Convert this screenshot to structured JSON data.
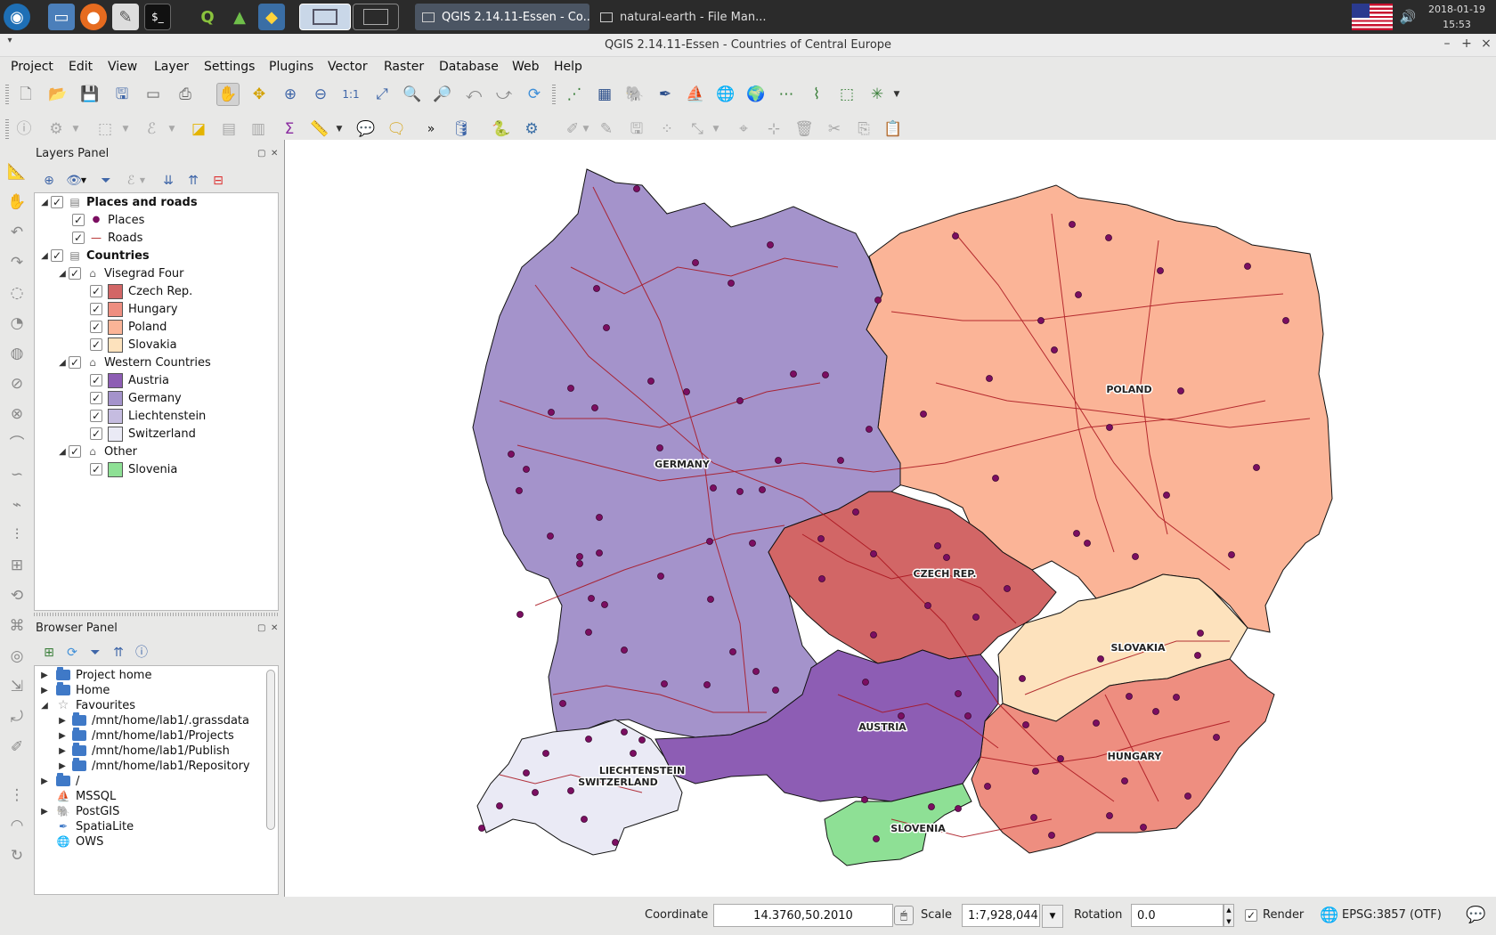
{
  "taskbar": {
    "tasks": [
      "QGIS 2.14.11-Essen - Co...",
      "natural-earth - File Man..."
    ],
    "clock_date": "2018-01-19",
    "clock_time": "15:53"
  },
  "window": {
    "title": "QGIS 2.14.11-Essen - Countries of Central Europe"
  },
  "menu": [
    "Project",
    "Edit",
    "View",
    "Layer",
    "Settings",
    "Plugins",
    "Vector",
    "Raster",
    "Database",
    "Web",
    "Help"
  ],
  "layers_panel": {
    "title": "Layers Panel",
    "groups": [
      {
        "name": "Places and roads",
        "items": [
          "Places",
          "Roads"
        ]
      },
      {
        "name": "Countries",
        "subgroups": [
          {
            "name": "Visegrad Four",
            "layers": [
              {
                "name": "Czech Rep.",
                "color": "#d26666"
              },
              {
                "name": "Hungary",
                "color": "#ee8e80"
              },
              {
                "name": "Poland",
                "color": "#fbb497"
              },
              {
                "name": "Slovakia",
                "color": "#fde2bd"
              }
            ]
          },
          {
            "name": "Western Countries",
            "layers": [
              {
                "name": "Austria",
                "color": "#8d5db4"
              },
              {
                "name": "Germany",
                "color": "#a493cb"
              },
              {
                "name": "Liechtenstein",
                "color": "#c5bce0"
              },
              {
                "name": "Switzerland",
                "color": "#eaeaf5"
              }
            ]
          },
          {
            "name": "Other",
            "layers": [
              {
                "name": "Slovenia",
                "color": "#8ee095"
              }
            ]
          }
        ]
      }
    ]
  },
  "browser_panel": {
    "title": "Browser Panel",
    "items": [
      "Project home",
      "Home",
      "Favourites",
      "/mnt/home/lab1/.grassdata",
      "/mnt/home/lab1/Projects",
      "/mnt/home/lab1/Publish",
      "/mnt/home/lab1/Repository",
      "/",
      "MSSQL",
      "PostGIS",
      "SpatiaLite",
      "OWS"
    ]
  },
  "map": {
    "country_labels": [
      "GERMANY",
      "POLAND",
      "CZECH REP.",
      "SLOVAKIA",
      "AUSTRIA",
      "HUNGARY",
      "LIECHTENSTEIN",
      "SWITZERLAND",
      "SLOVENIA"
    ]
  },
  "status": {
    "coordinate_label": "Coordinate",
    "coordinate_value": "14.3760,50.2010",
    "scale_label": "Scale",
    "scale_value": "1:7,928,044",
    "rotation_label": "Rotation",
    "rotation_value": "0.0",
    "render_label": "Render",
    "crs": "EPSG:3857 (OTF)"
  }
}
